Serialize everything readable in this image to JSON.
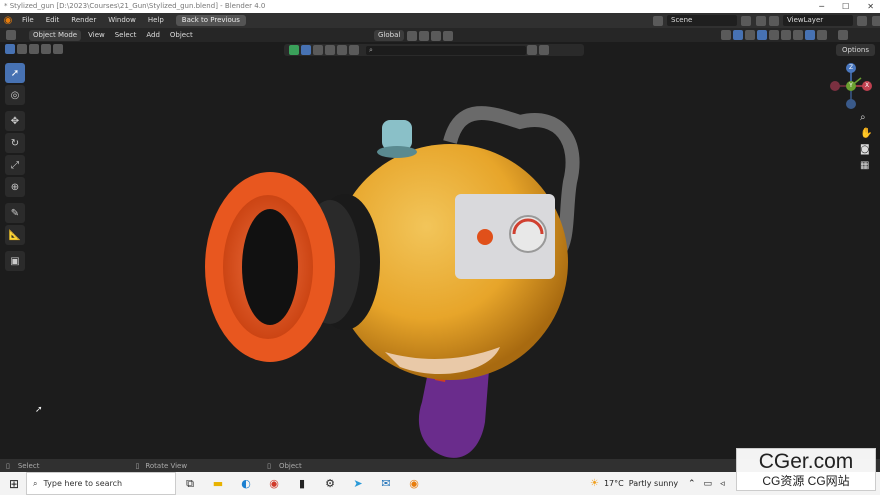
{
  "window": {
    "title": "* Stylized_gun [D:\\2023\\Courses\\21_Gun\\Stylized_gun.blend] - Blender 4.0"
  },
  "menu": {
    "items": [
      "File",
      "Edit",
      "Render",
      "Window",
      "Help"
    ],
    "back_button": "Back to Previous",
    "scene_label": "Scene",
    "viewlayer_label": "ViewLayer"
  },
  "header": {
    "mode": "Object Mode",
    "view": "View",
    "select": "Select",
    "add": "Add",
    "object": "Object",
    "transform_orientation": "Global",
    "options": "Options"
  },
  "status": {
    "left": "Select",
    "middle": "Rotate View",
    "right": "Object"
  },
  "taskbar": {
    "search_placeholder": "Type here to search",
    "weather_temp": "17°C",
    "weather_text": "Partly sunny"
  },
  "watermark": {
    "big": "CGer.com",
    "small": "CG资源 CG网站"
  },
  "gizmo": {
    "z": "Z",
    "x": "X",
    "y": "Y"
  },
  "colors": {
    "accent": "#4772b3",
    "body_yellow": "#e7b238",
    "barrel_orange": "#e8571f",
    "grip_purple": "#6a2c8c",
    "blender_orange": "#e87d0d"
  }
}
